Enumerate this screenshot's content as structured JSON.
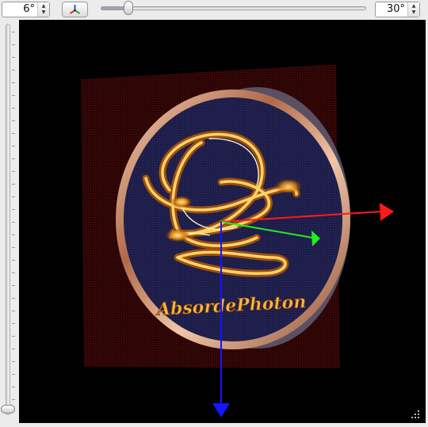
{
  "toolbar": {
    "left_angle_value": "6°",
    "right_angle_value": "30°",
    "axis_button_icon": "xyz-axes-icon",
    "horizontal_slider_level_percent": 9
  },
  "vertical_slider": {
    "level_percent": 0
  },
  "viewport": {
    "logo_text": "AbsordePhoton",
    "axis_colors": {
      "x": "#ff1a1a",
      "y": "#22ee22",
      "z": "#1515ff"
    },
    "background": "#000000",
    "grip_icon": "resize-grip-icon"
  }
}
